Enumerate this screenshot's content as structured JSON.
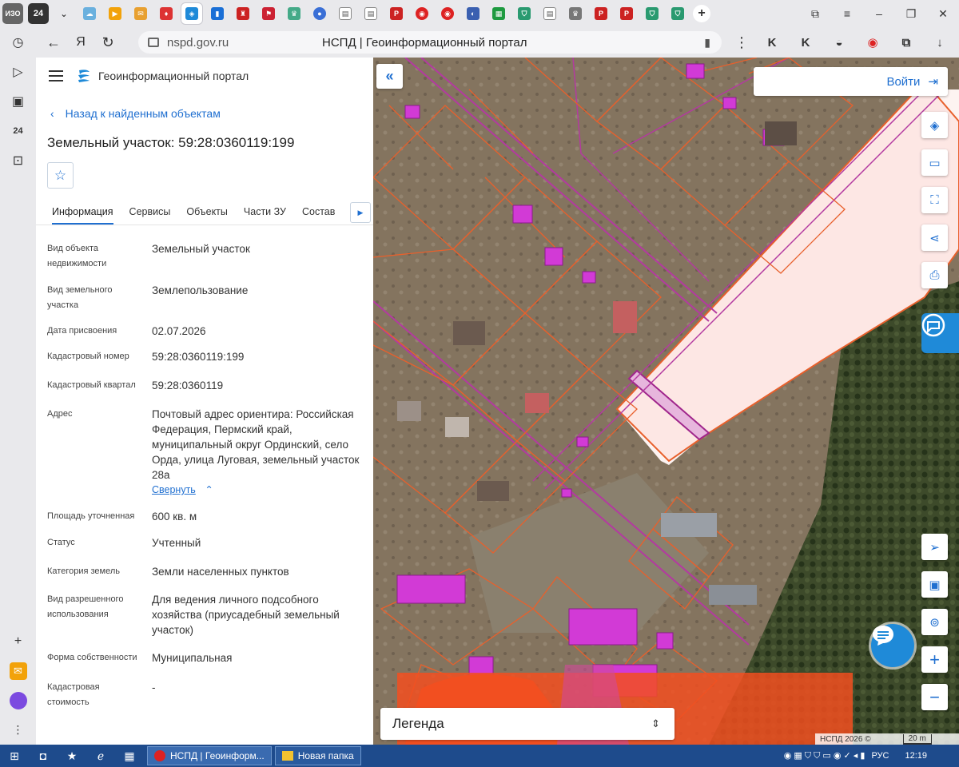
{
  "browser": {
    "url": "nspd.gov.ru",
    "page_title": "НСПД | Геоинформационный портал",
    "tab_icons": [
      "ИЗО",
      "24",
      "chevron-down",
      "cloud",
      "forward",
      "mail",
      "fox",
      "portal-active",
      "bars",
      "arms",
      "arms-red",
      "emblem",
      "globe",
      "doc",
      "doc",
      "pdf",
      "target",
      "target",
      "ball",
      "sheet",
      "shield",
      "doc",
      "emblem",
      "pdf",
      "pdf",
      "shield",
      "shield",
      "new-tab"
    ],
    "window_controls": [
      "pin",
      "menu",
      "minimize",
      "restore",
      "close"
    ]
  },
  "panel": {
    "portal_name": "Геоинформационный портал",
    "back_label": "Назад к найденным объектам",
    "title": "Земельный участок: 59:28:0360119:199",
    "tabs": [
      "Информация",
      "Сервисы",
      "Объекты",
      "Части ЗУ",
      "Состав"
    ],
    "collapse_label": "Свернуть",
    "fields": [
      {
        "label": "Вид объекта недвижимости",
        "value": "Земельный участок"
      },
      {
        "label": "Вид земельного участка",
        "value": "Землепользование"
      },
      {
        "label": "Дата присвоения",
        "value": "02.07.2026"
      },
      {
        "label": "Кадастровый номер",
        "value": "59:28:0360119:199"
      },
      {
        "label": "Кадастровый квартал",
        "value": "59:28:0360119"
      },
      {
        "label": "Адрес",
        "value": "Почтовый адрес ориентира: Российская Федерация, Пермский край, муниципальный округ Ординский, село Орда, улица Луговая, земельный участок 28а"
      },
      {
        "label": "Площадь уточненная",
        "value": "600 кв. м"
      },
      {
        "label": "Статус",
        "value": "Учтенный"
      },
      {
        "label": "Категория земель",
        "value": "Земли населенных пунктов"
      },
      {
        "label": "Вид разрешенного использования",
        "value": "Для ведения личного подсобного хозяйства (приусадебный земельный участок)"
      },
      {
        "label": "Форма собственности",
        "value": "Муниципальная"
      },
      {
        "label": "Кадастровая стоимость",
        "value": "-"
      }
    ]
  },
  "map": {
    "login_label": "Войти",
    "legend_label": "Легенда",
    "copyright": "НСПД 2026 ©",
    "scale_label": "20 m",
    "tools": [
      "layers-icon",
      "ruler-icon",
      "select-area-icon",
      "share-icon",
      "print-icon"
    ],
    "bottom_tools": [
      "locate-icon",
      "screen-icon",
      "geo-search-icon",
      "zoom-in-icon",
      "zoom-out-icon"
    ],
    "colors": {
      "parcel_border": "#e8602c",
      "building": "#d23ad6",
      "highlight": "#fde7e4",
      "accent": "#1f6fd0"
    }
  },
  "taskbar": {
    "tasks": [
      "НСПД | Геоинформ...",
      "Новая папка"
    ],
    "lang": "РУС",
    "time": "12:19"
  }
}
